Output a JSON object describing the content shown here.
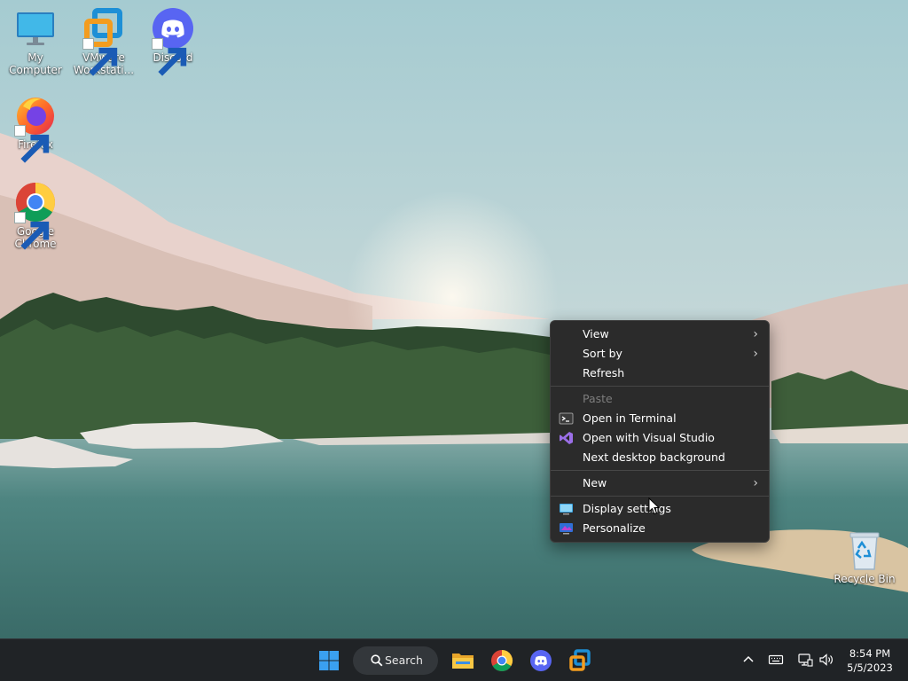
{
  "desktop": {
    "icons": [
      {
        "label": "My Computer",
        "icon": "monitor-icon"
      },
      {
        "label": "VMware Workstati...",
        "icon": "vmware-icon"
      },
      {
        "label": "Discord",
        "icon": "discord-icon"
      },
      {
        "label": "Firefox",
        "icon": "firefox-icon"
      },
      {
        "label": "Google Chrome",
        "icon": "chrome-icon"
      },
      {
        "label": "Recycle Bin",
        "icon": "recycle-bin-icon"
      }
    ]
  },
  "context_menu": {
    "items": [
      {
        "label": "View",
        "submenu": true
      },
      {
        "label": "Sort by",
        "submenu": true
      },
      {
        "label": "Refresh"
      },
      {
        "label": "Paste",
        "disabled": true
      },
      {
        "label": "Open in Terminal",
        "icon": "terminal-icon"
      },
      {
        "label": "Open with Visual Studio",
        "icon": "visual-studio-icon"
      },
      {
        "label": "Next desktop background"
      },
      {
        "label": "New",
        "submenu": true
      },
      {
        "label": "Display settings",
        "icon": "display-icon"
      },
      {
        "label": "Personalize",
        "icon": "personalize-icon"
      }
    ]
  },
  "taskbar": {
    "search_label": "Search",
    "pinned": [
      "start-icon",
      "file-explorer-icon",
      "chrome-icon",
      "discord-icon",
      "vmware-icon"
    ],
    "tray": [
      "chevron-up-icon",
      "keyboard-icon",
      "network-icon",
      "volume-icon"
    ],
    "time": "8:54 PM",
    "date": "5/5/2023"
  },
  "colors": {
    "menu_bg": "#2b2b2b",
    "taskbar_bg": "#202326",
    "discord": "#5865f2",
    "vmware_blue": "#1d8fd6",
    "vmware_orange": "#f39c1f"
  }
}
